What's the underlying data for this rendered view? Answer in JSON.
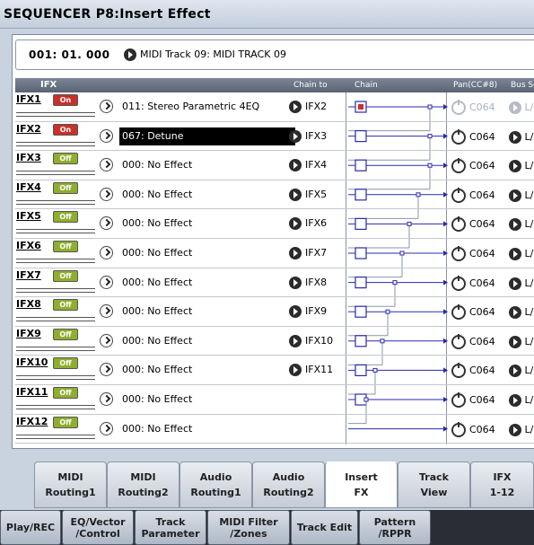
{
  "window": {
    "title": "SEQUENCER P8:Insert Effect"
  },
  "location": {
    "position": "001: 01. 000",
    "track": "MIDI Track 09: MIDI TRACK 09"
  },
  "header": {
    "ifx": "IFX",
    "chain_to": "Chain to",
    "chain": "Chain",
    "pan": "Pan(CC#8)",
    "bus": "Bus Se"
  },
  "rows": [
    {
      "label": "IFX1",
      "state": "On",
      "effect": "011: Stereo Parametric 4EQ",
      "chain_to": "IFX2",
      "pan": "C064",
      "bus": "L/"
    },
    {
      "label": "IFX2",
      "state": "On",
      "effect": "067: Detune",
      "chain_to": "IFX3",
      "pan": "C064",
      "bus": "L/"
    },
    {
      "label": "IFX3",
      "state": "Off",
      "effect": "000: No Effect",
      "chain_to": "IFX4",
      "pan": "C064",
      "bus": "L/"
    },
    {
      "label": "IFX4",
      "state": "Off",
      "effect": "000: No Effect",
      "chain_to": "IFX5",
      "pan": "C064",
      "bus": "L/"
    },
    {
      "label": "IFX5",
      "state": "Off",
      "effect": "000: No Effect",
      "chain_to": "IFX6",
      "pan": "C064",
      "bus": "L/"
    },
    {
      "label": "IFX6",
      "state": "Off",
      "effect": "000: No Effect",
      "chain_to": "IFX7",
      "pan": "C064",
      "bus": "L/"
    },
    {
      "label": "IFX7",
      "state": "Off",
      "effect": "000: No Effect",
      "chain_to": "IFX8",
      "pan": "C064",
      "bus": "L/"
    },
    {
      "label": "IFX8",
      "state": "Off",
      "effect": "000: No Effect",
      "chain_to": "IFX9",
      "pan": "C064",
      "bus": "L/"
    },
    {
      "label": "IFX9",
      "state": "Off",
      "effect": "000: No Effect",
      "chain_to": "IFX10",
      "pan": "C064",
      "bus": "L/"
    },
    {
      "label": "IFX10",
      "state": "Off",
      "effect": "000: No Effect",
      "chain_to": "IFX11",
      "pan": "C064",
      "bus": "L/"
    },
    {
      "label": "IFX11",
      "state": "Off",
      "effect": "000: No Effect",
      "chain_to": "",
      "pan": "C064",
      "bus": "L/"
    },
    {
      "label": "IFX12",
      "state": "Off",
      "effect": "000: No Effect",
      "chain_to": "",
      "pan": "C064",
      "bus": "L/"
    }
  ],
  "tabs": [
    {
      "label": "MIDI\nRouting1"
    },
    {
      "label": "MIDI\nRouting2"
    },
    {
      "label": "Audio\nRouting1"
    },
    {
      "label": "Audio\nRouting2"
    },
    {
      "label": "Insert\nFX"
    },
    {
      "label": "Track\nView"
    },
    {
      "label": "IFX\n1-12"
    }
  ],
  "bottom_tabs": [
    {
      "label": "Play/REC"
    },
    {
      "label": "EQ/Vector\n/Control"
    },
    {
      "label": "Track\nParameter"
    },
    {
      "label": "MIDI Filter\n/Zones"
    },
    {
      "label": "Track Edit"
    },
    {
      "label": "Pattern\n/RPPR"
    }
  ],
  "colors": {
    "on": "#c8302a",
    "off": "#8fae2f",
    "chain_line": "#2a2aa8",
    "selected_bg": "#000000"
  }
}
